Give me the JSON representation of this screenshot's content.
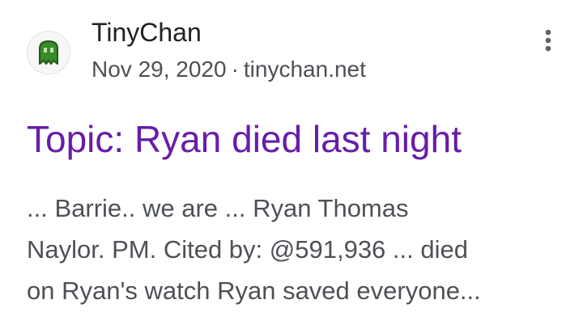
{
  "result": {
    "site_name": "TinyChan",
    "date": "Nov 29, 2020",
    "separator": "·",
    "domain": "tinychan.net",
    "title": "Topic: Ryan died last night",
    "snippet_lines": [
      "... Barrie.. we are ... Ryan Thomas",
      "Naylor. PM. Cited by: @591,936 ... died",
      "on Ryan's watch Ryan saved everyone..."
    ]
  },
  "icons": {
    "favicon": "tinychan-logo-icon",
    "menu": "more-vert-icon"
  },
  "colors": {
    "title_visited": "#681da8",
    "site_name": "#202124",
    "secondary_text": "#4d5156",
    "favicon_green": "#3a8a2a",
    "menu_dots": "#5f6368"
  }
}
